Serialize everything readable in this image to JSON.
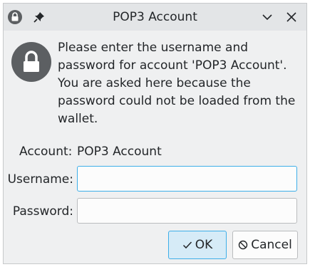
{
  "window": {
    "title": "POP3 Account"
  },
  "message": "Please enter the username and\npassword for account 'POP3 Account'.\nYou are asked here because the\npassword could not be loaded from the\nwallet.",
  "account": {
    "label": "Account:",
    "value": "POP3 Account"
  },
  "username": {
    "label": "Username:",
    "value": ""
  },
  "password": {
    "label": "Password:",
    "value": ""
  },
  "buttons": {
    "ok": "OK",
    "cancel": "Cancel"
  },
  "icons": {
    "ok": "check-icon",
    "cancel": "cancel-icon",
    "lock": "lock-icon",
    "pin": "pin-icon",
    "minimize": "chevron-down-icon",
    "close": "close-icon"
  },
  "colors": {
    "accent": "#3daee9",
    "window_bg": "#eff0f1",
    "titlebar_bg": "#e3e5e7",
    "icon_dark": "#5c5f62"
  }
}
